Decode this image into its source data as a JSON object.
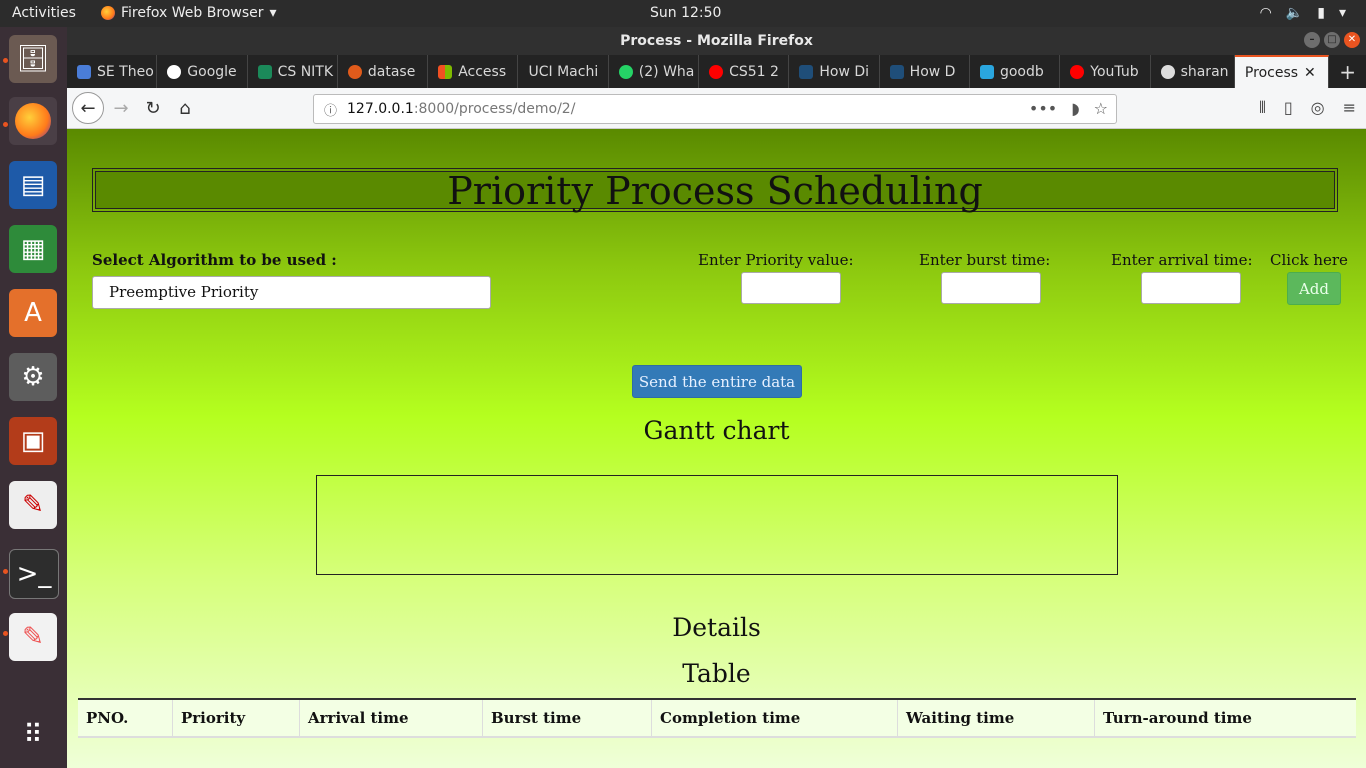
{
  "os": {
    "activities": "Activities",
    "app_name": "Firefox Web Browser",
    "clock": "Sun 12:50"
  },
  "window": {
    "title": "Process - Mozilla Firefox"
  },
  "tabs": [
    {
      "label": "SE Theo",
      "color": "#4a7dd8"
    },
    {
      "label": "Google",
      "color": "#ffffff"
    },
    {
      "label": "CS NITK",
      "color": "#1b8a5a"
    },
    {
      "label": "datase",
      "color": "#e05b1b"
    },
    {
      "label": "Access",
      "color": "#f25022"
    },
    {
      "label": "UCI Machi",
      "color": "#232323"
    },
    {
      "label": "(2) Wha",
      "color": "#25d366"
    },
    {
      "label": "CS51 2",
      "color": "#ff0000"
    },
    {
      "label": "How Di",
      "color": "#1f4e79"
    },
    {
      "label": "How D",
      "color": "#1f4e79"
    },
    {
      "label": "goodb",
      "color": "#2aa6df"
    },
    {
      "label": "YouTub",
      "color": "#ff0000"
    },
    {
      "label": "sharan",
      "color": "#dddddd"
    },
    {
      "label": "Process",
      "color": "#f5f6f7",
      "active": true
    }
  ],
  "url": {
    "host": "127.0.0.1",
    "path": ":8000/process/demo/2/"
  },
  "page": {
    "title": "Priority Process Scheduling",
    "algorithm_label": "Select Algorithm to be used :",
    "algorithm_value": "Preemptive Priority",
    "priority_label": "Enter Priority value:",
    "burst_label": "Enter burst time:",
    "arrival_label": "Enter arrival time:",
    "click_label": "Click here",
    "add_button": "Add",
    "send_button": "Send the entire data",
    "gantt_title": "Gantt chart",
    "details_title": "Details",
    "table_title": "Table",
    "table_headers": [
      "PNO.",
      "Priority",
      "Arrival time",
      "Burst time",
      "Completion time",
      "Waiting time",
      "Turn-around time"
    ]
  },
  "colors": {
    "accent": "#e95420",
    "add_button": "#5cb85c",
    "send_button": "#337ab7"
  }
}
